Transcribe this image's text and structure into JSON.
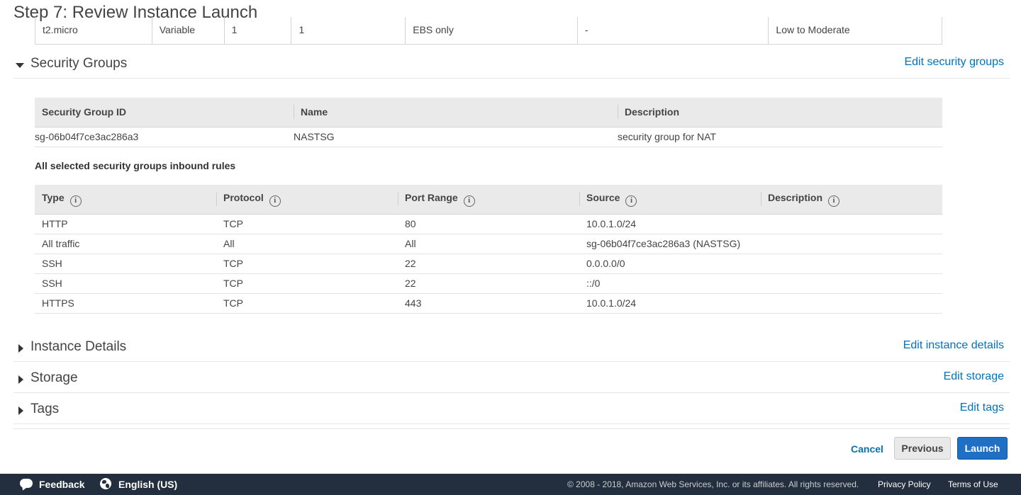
{
  "page": {
    "title": "Step 7: Review Instance Launch"
  },
  "instance_type_row": [
    "t2.micro",
    "Variable",
    "1",
    "1",
    "EBS only",
    "-",
    "Low to Moderate"
  ],
  "sections": {
    "security_groups": {
      "title": "Security Groups",
      "edit": "Edit security groups"
    },
    "instance_details": {
      "title": "Instance Details",
      "edit": "Edit instance details"
    },
    "storage": {
      "title": "Storage",
      "edit": "Edit storage"
    },
    "tags": {
      "title": "Tags",
      "edit": "Edit tags"
    }
  },
  "sg_table": {
    "headers": [
      "Security Group ID",
      "Name",
      "Description"
    ],
    "rows": [
      [
        "sg-06b04f7ce3ac286a3",
        "NASTSG",
        "security group for NAT"
      ]
    ]
  },
  "inbound": {
    "title": "All selected security groups inbound rules",
    "headers": [
      "Type",
      "Protocol",
      "Port Range",
      "Source",
      "Description"
    ],
    "info_glyph": "i",
    "rows": [
      [
        "HTTP",
        "TCP",
        "80",
        "10.0.1.0/24",
        ""
      ],
      [
        "All traffic",
        "All",
        "All",
        "sg-06b04f7ce3ac286a3 (NASTSG)",
        ""
      ],
      [
        "SSH",
        "TCP",
        "22",
        "0.0.0.0/0",
        ""
      ],
      [
        "SSH",
        "TCP",
        "22",
        "::/0",
        ""
      ],
      [
        "HTTPS",
        "TCP",
        "443",
        "10.0.1.0/24",
        ""
      ]
    ]
  },
  "actions": {
    "cancel": "Cancel",
    "previous": "Previous",
    "launch": "Launch"
  },
  "footer": {
    "feedback": "Feedback",
    "language": "English (US)",
    "copyright": "© 2008 - 2018, Amazon Web Services, Inc. or its affiliates. All rights reserved.",
    "privacy": "Privacy Policy",
    "terms": "Terms of Use"
  },
  "colors": {
    "link": "#0073bb",
    "primary": "#1f6fc5",
    "footer_bg": "#232f3e"
  }
}
